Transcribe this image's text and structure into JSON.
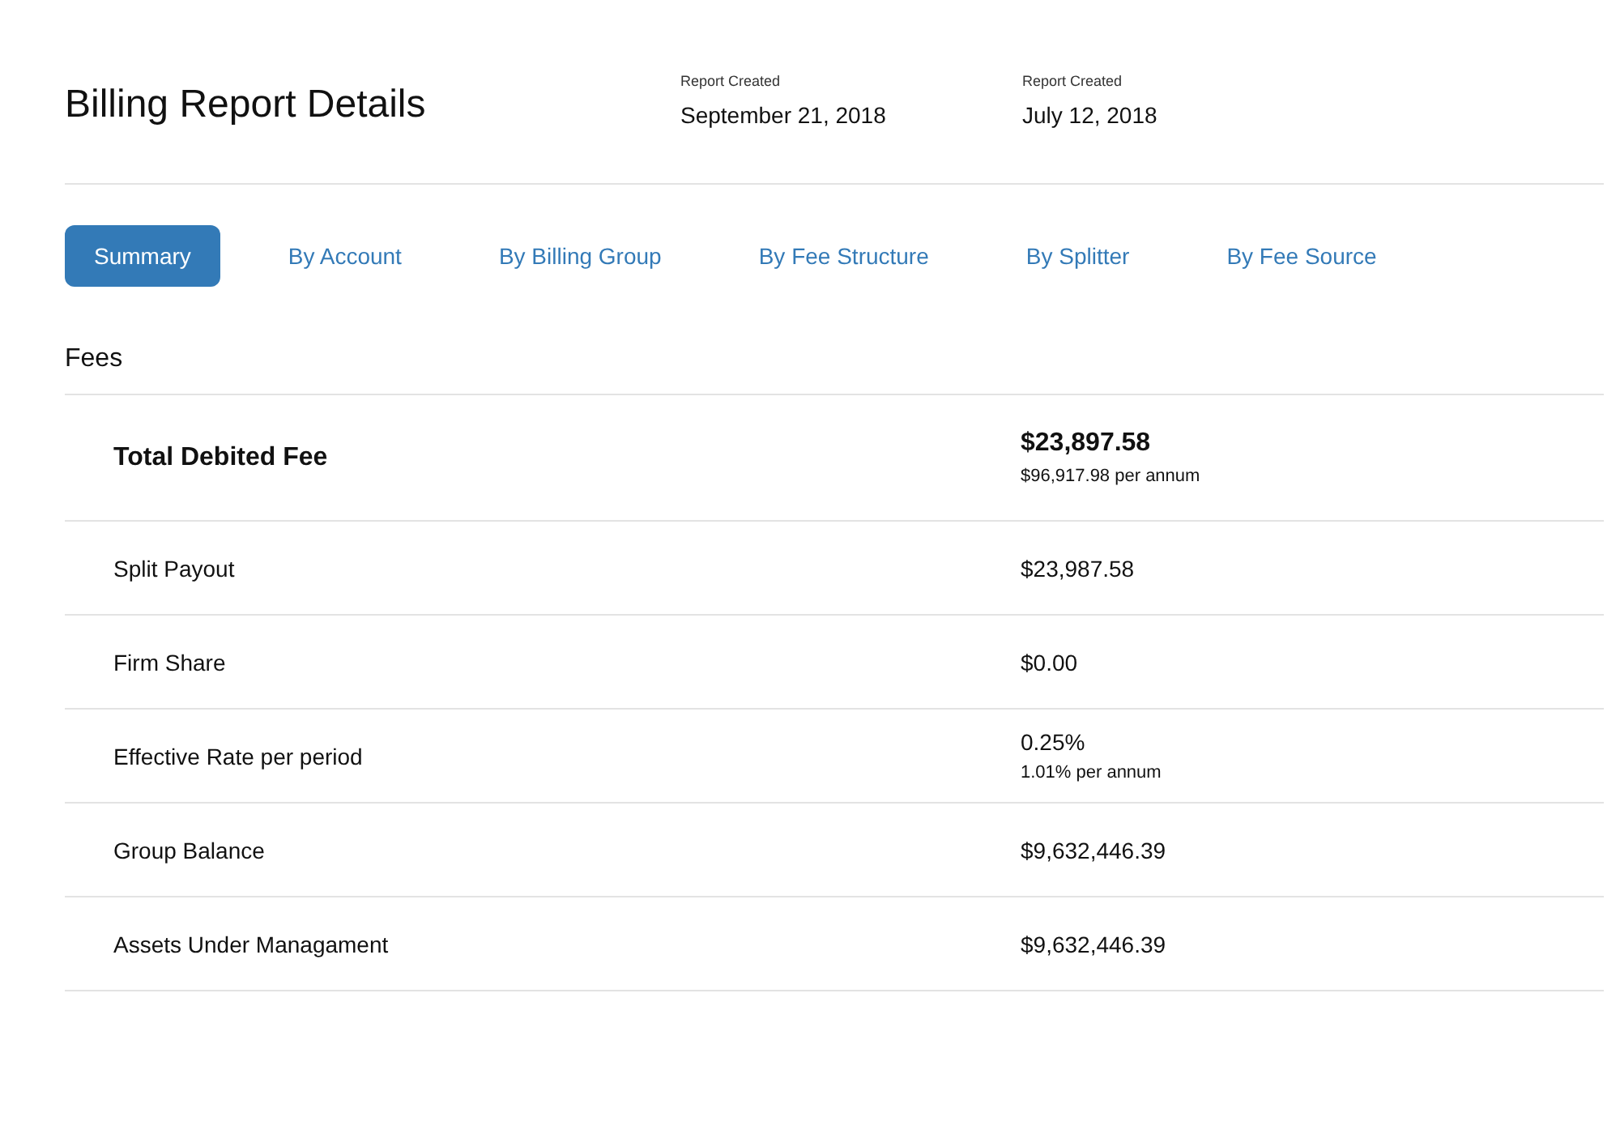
{
  "header": {
    "title": "Billing Report Details",
    "dates": [
      {
        "label": "Report Created",
        "value": "September 21, 2018"
      },
      {
        "label": "Report Created",
        "value": "July 12, 2018"
      }
    ]
  },
  "tabs": [
    {
      "label": "Summary",
      "selected": true
    },
    {
      "label": "By Account",
      "selected": false
    },
    {
      "label": "By Billing Group",
      "selected": false
    },
    {
      "label": "By Fee Structure",
      "selected": false
    },
    {
      "label": "By Splitter",
      "selected": false
    },
    {
      "label": "By Fee Source",
      "selected": false
    }
  ],
  "section": {
    "title": "Fees",
    "rows": [
      {
        "label": "Total Debited Fee",
        "value": "$23,897.58",
        "sub": "$96,917.98 per annum",
        "emphasis": true
      },
      {
        "label": "Split Payout",
        "value": "$23,987.58",
        "emphasis": false
      },
      {
        "label": "Firm Share",
        "value": "$0.00",
        "emphasis": false
      },
      {
        "label": "Effective Rate per period",
        "value": "0.25%",
        "sub": "1.01% per annum",
        "emphasis": false
      },
      {
        "label": "Group Balance",
        "value": "$9,632,446.39",
        "emphasis": false
      },
      {
        "label": "Assets Under Managament",
        "value": "$9,632,446.39",
        "emphasis": false
      }
    ]
  }
}
